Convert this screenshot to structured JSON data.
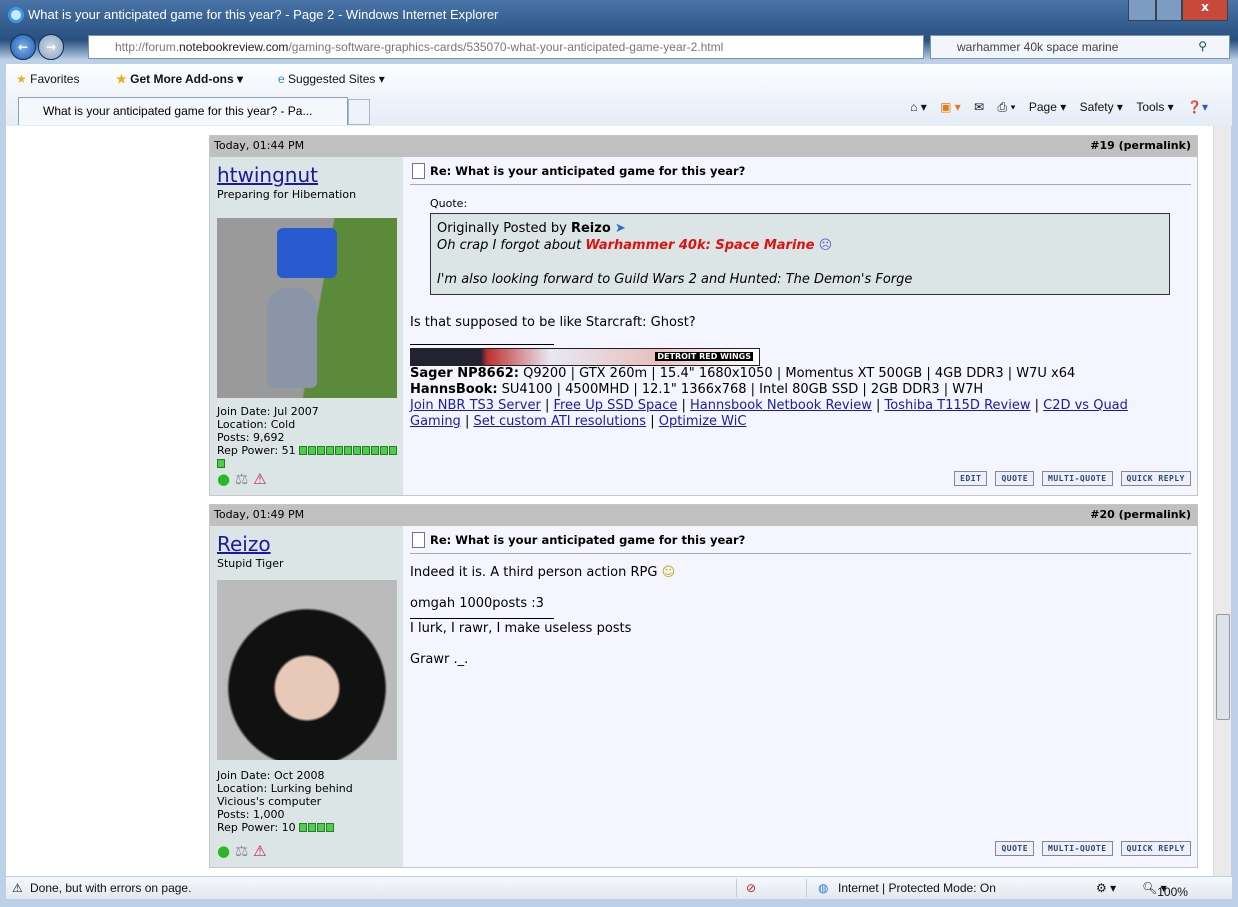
{
  "window": {
    "title": "What is your anticipated game for this year? - Page 2 - Windows Internet Explorer"
  },
  "address": {
    "url_prefix": "http://forum.",
    "url_domain": "notebookreview.com",
    "url_path": "/gaming-software-graphics-cards/535070-what-your-anticipated-game-year-2.html"
  },
  "search": {
    "value": "warhammer 40k space marine"
  },
  "favbar": {
    "favorites": "Favorites",
    "addons": "Get More Add-ons ▾",
    "suggested": "Suggested Sites ▾"
  },
  "tab": {
    "label": "What is your anticipated game for this year? - Pa..."
  },
  "tools": {
    "page": "Page ▾",
    "safety": "Safety ▾",
    "tools": "Tools ▾"
  },
  "buttons": {
    "edit": "EDIT",
    "quote": "QUOTE",
    "multi": "MULTI-QUOTE",
    "reply": "QUICK REPLY"
  },
  "posts": [
    {
      "date": "Today, 01:44 PM",
      "num": "#19",
      "permalink": "permalink",
      "user": "htwingnut",
      "utitle": "Preparing for Hibernation",
      "join": "Join Date: Jul 2007",
      "location": "Location: Cold",
      "posts": "Posts: 9,692",
      "rep": "Rep Power: 51",
      "rep_bars": 12,
      "title": "Re: What is your anticipated game for this year?",
      "quote_label": "Quote:",
      "quote_by": "Originally Posted by ",
      "quote_author": "Reizo",
      "quote_l1": "Oh crap I forgot about ",
      "quote_hl": "Warhammer 40k: Space Marine",
      "quote_l2": "I'm also looking forward to Guild Wars 2 and Hunted: The Demon's Forge",
      "text": "Is that supposed to be like Starcraft: Ghost?",
      "banner": "DETROIT RED WINGS",
      "sig1_b": "Sager NP8662:",
      "sig1": " Q9200 | GTX 260m | 15.4\" 1680x1050 | Momentus XT 500GB | 4GB DDR3 | W7U x64",
      "sig2_b": "HannsBook:",
      "sig2": " SU4100 | 4500MHD | 12.1\" 1366x768 | Intel 80GB SSD | 2GB DDR3 | W7H",
      "links": [
        "Join NBR TS3 Server",
        "Free Up SSD Space",
        "Hannsbook Netbook Review",
        "Toshiba T115D Review",
        "C2D vs Quad Gaming",
        "Set custom ATI resolutions",
        "Optimize WiC"
      ]
    },
    {
      "date": "Today, 01:49 PM",
      "num": "#20",
      "permalink": "permalink",
      "user": "Reizo",
      "utitle": "Stupid Tiger",
      "join": "Join Date: Oct 2008",
      "location": "Location: Lurking behind Vicious's computer",
      "posts": "Posts: 1,000",
      "rep": "Rep Power: 10",
      "rep_bars": 4,
      "title": "Re: What is your anticipated game for this year?",
      "text": "Indeed it is. A third person action RPG",
      "t2": "omgah 1000posts :3",
      "t3": "I lurk, I rawr, I make useless posts",
      "t4": "Grawr ._."
    }
  ],
  "status": {
    "text": "Done, but with errors on page.",
    "zone": "Internet | Protected Mode: On",
    "zoom": "100%"
  }
}
